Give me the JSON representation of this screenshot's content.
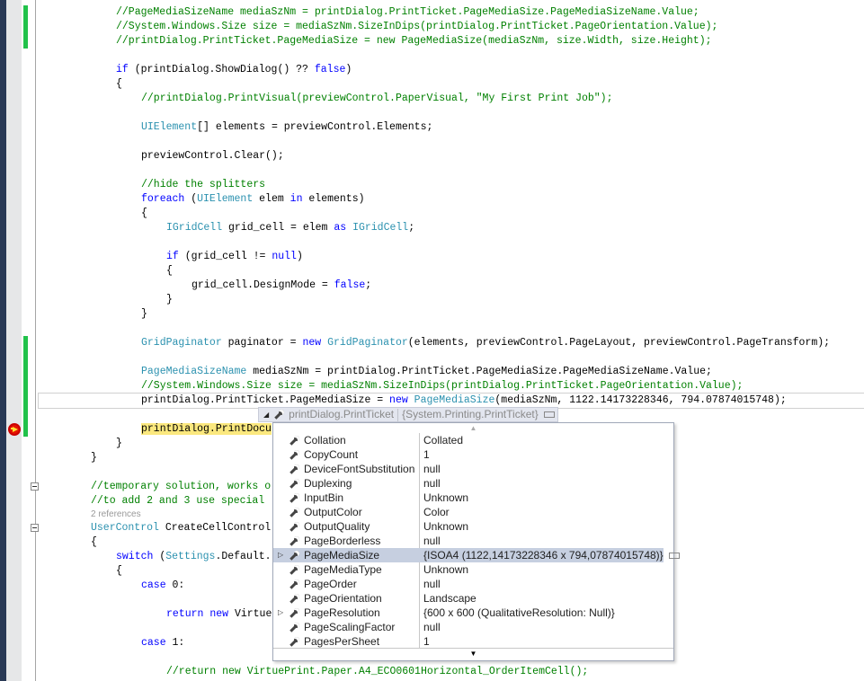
{
  "colors": {
    "keyword": "#0000ff",
    "type": "#2b91af",
    "comment": "#008000",
    "change_bar": "#21c24a",
    "current_statement": "#fbe87e"
  },
  "code": [
    {
      "i": 1,
      "t": [
        [
          "c",
          "//PageMediaSizeName mediaSzNm = printDialog.PrintTicket.PageMediaSize.PageMediaSizeName.Value;"
        ]
      ]
    },
    {
      "i": 1,
      "t": [
        [
          "c",
          "//System.Windows.Size size = mediaSzNm.SizeInDips(printDialog.PrintTicket.PageOrientation.Value);"
        ]
      ]
    },
    {
      "i": 1,
      "t": [
        [
          "c",
          "//printDialog.PrintTicket.PageMediaSize = new PageMediaSize(mediaSzNm, size.Width, size.Height);"
        ]
      ]
    },
    {
      "i": 0,
      "t": []
    },
    {
      "i": 1,
      "t": [
        [
          "k",
          "if"
        ],
        [
          "p",
          " (printDialog.ShowDialog() ?? "
        ],
        [
          "k",
          "false"
        ],
        [
          "p",
          ")"
        ]
      ]
    },
    {
      "i": 1,
      "t": [
        [
          "p",
          "{"
        ]
      ]
    },
    {
      "i": 2,
      "t": [
        [
          "c",
          "//printDialog.PrintVisual(previewControl.PaperVisual, \"My First Print Job\");"
        ]
      ]
    },
    {
      "i": 0,
      "t": []
    },
    {
      "i": 2,
      "t": [
        [
          "t",
          "UIElement"
        ],
        [
          "p",
          "[] elements = previewControl.Elements;"
        ]
      ]
    },
    {
      "i": 0,
      "t": []
    },
    {
      "i": 2,
      "t": [
        [
          "p",
          "previewControl.Clear();"
        ]
      ]
    },
    {
      "i": 0,
      "t": []
    },
    {
      "i": 2,
      "t": [
        [
          "c",
          "//hide the splitters"
        ]
      ]
    },
    {
      "i": 2,
      "t": [
        [
          "k",
          "foreach"
        ],
        [
          "p",
          " ("
        ],
        [
          "t",
          "UIElement"
        ],
        [
          "p",
          " elem "
        ],
        [
          "k",
          "in"
        ],
        [
          "p",
          " elements)"
        ]
      ]
    },
    {
      "i": 2,
      "t": [
        [
          "p",
          "{"
        ]
      ]
    },
    {
      "i": 3,
      "t": [
        [
          "t",
          "IGridCell"
        ],
        [
          "p",
          " grid_cell = elem "
        ],
        [
          "k",
          "as"
        ],
        [
          "p",
          " "
        ],
        [
          "t",
          "IGridCell"
        ],
        [
          "p",
          ";"
        ]
      ]
    },
    {
      "i": 0,
      "t": []
    },
    {
      "i": 3,
      "t": [
        [
          "k",
          "if"
        ],
        [
          "p",
          " (grid_cell != "
        ],
        [
          "k",
          "null"
        ],
        [
          "p",
          ")"
        ]
      ]
    },
    {
      "i": 3,
      "t": [
        [
          "p",
          "{"
        ]
      ]
    },
    {
      "i": 4,
      "t": [
        [
          "p",
          "grid_cell.DesignMode = "
        ],
        [
          "k",
          "false"
        ],
        [
          "p",
          ";"
        ]
      ]
    },
    {
      "i": 3,
      "t": [
        [
          "p",
          "}"
        ]
      ]
    },
    {
      "i": 2,
      "t": [
        [
          "p",
          "}"
        ]
      ]
    },
    {
      "i": 0,
      "t": []
    },
    {
      "i": 2,
      "t": [
        [
          "t",
          "GridPaginator"
        ],
        [
          "p",
          " paginator = "
        ],
        [
          "k",
          "new"
        ],
        [
          "p",
          " "
        ],
        [
          "t",
          "GridPaginator"
        ],
        [
          "p",
          "(elements, previewControl.PageLayout, previewControl.PageTransform);"
        ]
      ]
    },
    {
      "i": 0,
      "t": []
    },
    {
      "i": 2,
      "t": [
        [
          "t",
          "PageMediaSizeName"
        ],
        [
          "p",
          " mediaSzNm = printDialog.PrintTicket.PageMediaSize.PageMediaSizeName.Value;"
        ]
      ]
    },
    {
      "i": 2,
      "t": [
        [
          "c",
          "//System.Windows.Size size = mediaSzNm.SizeInDips(printDialog.PrintTicket.PageOrientation.Value);"
        ]
      ]
    },
    {
      "i": 2,
      "cur": true,
      "t": [
        [
          "p",
          "printDialog.PrintTicket.PageMediaSize = "
        ],
        [
          "k",
          "new"
        ],
        [
          "p",
          " "
        ],
        [
          "t",
          "PageMediaSize"
        ],
        [
          "p",
          "(mediaSzNm, 1122.14173228346, 794.07874015748);"
        ]
      ]
    },
    {
      "i": 0,
      "t": []
    },
    {
      "i": 2,
      "t": [
        [
          "h",
          "printDialog.PrintDocu"
        ]
      ]
    },
    {
      "i": 1,
      "t": [
        [
          "p",
          "}"
        ]
      ]
    },
    {
      "i": 0,
      "t": [
        [
          "p",
          "}"
        ]
      ]
    },
    {
      "i": 0,
      "t": []
    },
    {
      "i": 0,
      "t": [
        [
          "c",
          "//temporary solution, works o"
        ]
      ]
    },
    {
      "i": 0,
      "t": [
        [
          "c",
          "//to add 2 and 3 use special"
        ]
      ]
    },
    {
      "i": 0,
      "lens": true,
      "t": [
        [
          "p",
          "2 references"
        ]
      ]
    },
    {
      "i": 0,
      "t": [
        [
          "t",
          "UserControl"
        ],
        [
          "p",
          " CreateCellControl"
        ]
      ]
    },
    {
      "i": 0,
      "t": [
        [
          "p",
          "{"
        ]
      ]
    },
    {
      "i": 1,
      "t": [
        [
          "k",
          "switch"
        ],
        [
          "p",
          " ("
        ],
        [
          "t",
          "Settings"
        ],
        [
          "p",
          ".Default."
        ]
      ]
    },
    {
      "i": 1,
      "t": [
        [
          "p",
          "{"
        ]
      ]
    },
    {
      "i": 2,
      "t": [
        [
          "k",
          "case"
        ],
        [
          "p",
          " 0:"
        ]
      ]
    },
    {
      "i": 0,
      "t": []
    },
    {
      "i": 3,
      "t": [
        [
          "k",
          "return"
        ],
        [
          "p",
          " "
        ],
        [
          "k",
          "new"
        ],
        [
          "p",
          " Virtue"
        ]
      ]
    },
    {
      "i": 0,
      "t": []
    },
    {
      "i": 2,
      "t": [
        [
          "k",
          "case"
        ],
        [
          "p",
          " 1:"
        ]
      ]
    },
    {
      "i": 0,
      "t": []
    },
    {
      "i": 3,
      "t": [
        [
          "c",
          "//return new VirtuePrint.Paper.A4_ECO0601Horizontal_OrderItemCell();"
        ]
      ]
    }
  ],
  "datatip": {
    "expression": "printDialog.PrintTicket",
    "type": "{System.Printing.PrintTicket}",
    "rows": [
      {
        "name": "Collation",
        "value": "Collated"
      },
      {
        "name": "CopyCount",
        "value": "1"
      },
      {
        "name": "DeviceFontSubstitution",
        "value": "null"
      },
      {
        "name": "Duplexing",
        "value": "null"
      },
      {
        "name": "InputBin",
        "value": "Unknown"
      },
      {
        "name": "OutputColor",
        "value": "Color"
      },
      {
        "name": "OutputQuality",
        "value": "Unknown"
      },
      {
        "name": "PageBorderless",
        "value": "null"
      },
      {
        "name": "PageMediaSize",
        "value": "{ISOA4 (1122,14173228346 x 794,07874015748)}",
        "expandable": true,
        "selected": true
      },
      {
        "name": "PageMediaType",
        "value": "Unknown"
      },
      {
        "name": "PageOrder",
        "value": "null"
      },
      {
        "name": "PageOrientation",
        "value": "Landscape"
      },
      {
        "name": "PageResolution",
        "value": "{600 x 600 (QualitativeResolution: Null)}",
        "expandable": true
      },
      {
        "name": "PageScalingFactor",
        "value": "null"
      },
      {
        "name": "PagesPerSheet",
        "value": "1"
      }
    ]
  }
}
